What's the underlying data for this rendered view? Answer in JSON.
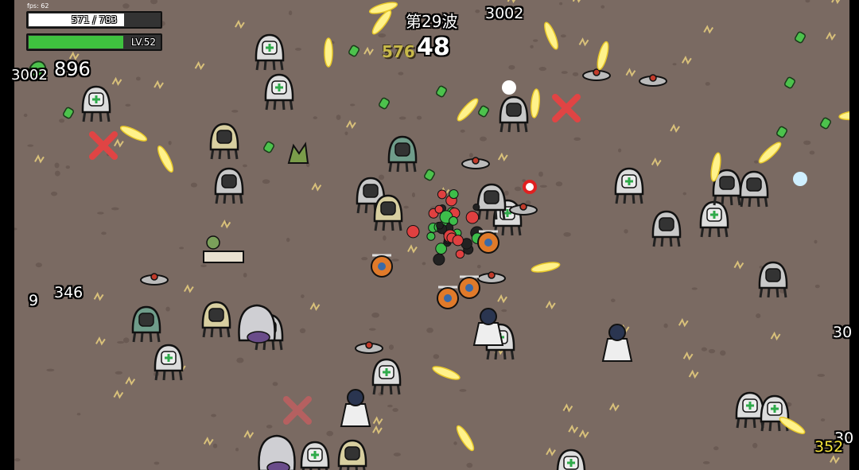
{
  "hud": {
    "fps": "fps: 62",
    "hp_text": "571 / 783",
    "hp_fraction": 0.73,
    "level_text": "LV.52",
    "xp_fraction": 0.72,
    "wave_text": "第29波",
    "timer": "48",
    "harvest": "576",
    "materials": "896",
    "colors": {
      "hp": "#ffffff",
      "xp": "#3fc23f",
      "bar_bg": "#333333",
      "ground": "#7a6a62"
    }
  },
  "damage_numbers": [
    {
      "text": "3002",
      "color": "white"
    },
    {
      "text": "3002",
      "color": "white"
    },
    {
      "text": "346",
      "color": "white"
    },
    {
      "text": "9",
      "color": "white"
    },
    {
      "text": "30",
      "color": "white"
    },
    {
      "text": "30",
      "color": "white"
    },
    {
      "text": "352",
      "color": "yellow"
    }
  ],
  "entities": {
    "player": "potato-character",
    "enemies": [
      "medic-robot-icon",
      "helmet-robot-icon",
      "turret-landmine-icon",
      "ghost-beast-icon",
      "flying-drone-icon",
      "robot-shrine-icon",
      "tree-icon"
    ],
    "projectiles": "yellow-bullet-icon",
    "pickups": "green-material-icon",
    "markers": "red-cross-marker-icon"
  }
}
